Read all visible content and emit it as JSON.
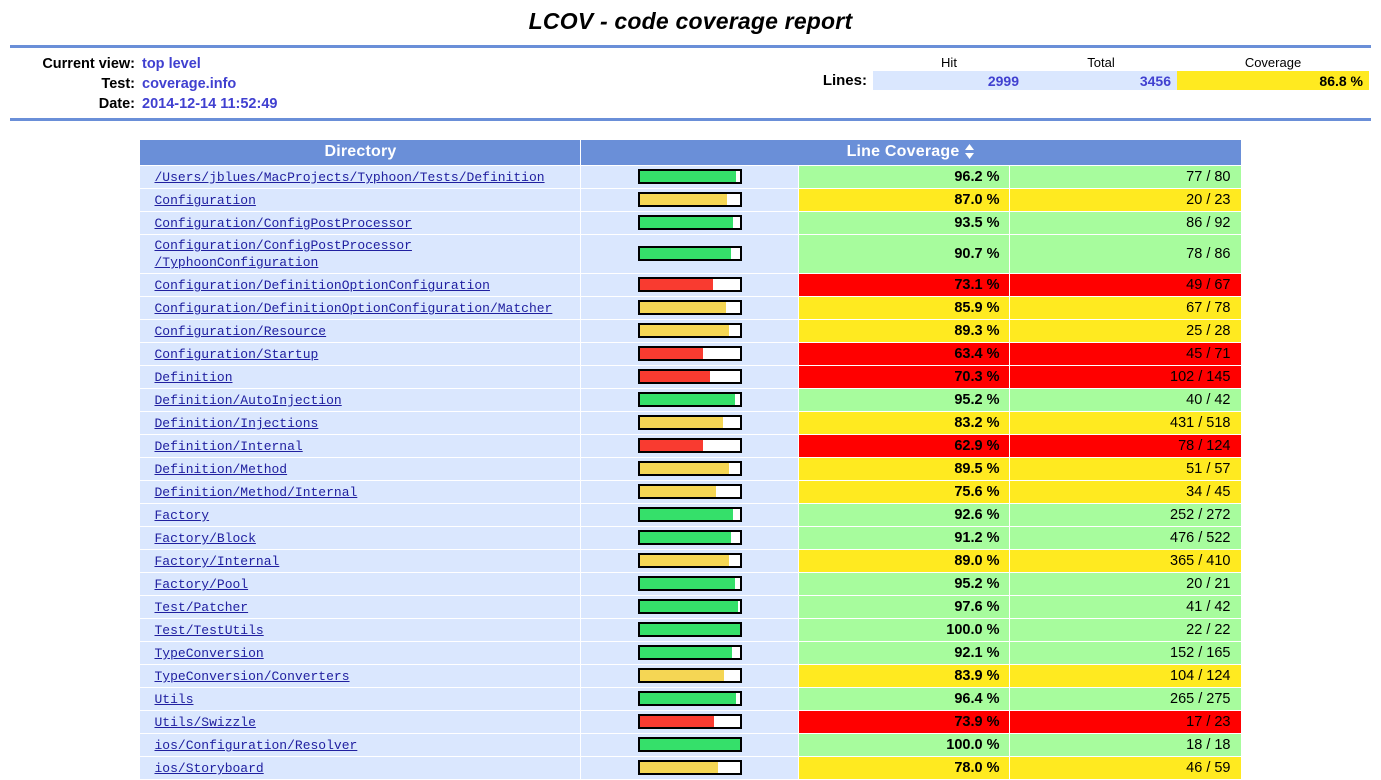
{
  "title": "LCOV - code coverage report",
  "info": {
    "rows": [
      {
        "label": "Current view:",
        "value": "top level"
      },
      {
        "label": "Test:",
        "value": "coverage.info"
      },
      {
        "label": "Date:",
        "value": "2014-12-14 11:52:49"
      }
    ],
    "summary": {
      "headers": {
        "hit": "Hit",
        "total": "Total",
        "coverage": "Coverage"
      },
      "row_label": "Lines:",
      "hit": "2999",
      "total": "3456",
      "coverage": "86.8 %"
    }
  },
  "table": {
    "headers": {
      "directory": "Directory",
      "coverage": "Line Coverage"
    },
    "sort_icon": "sort-updown-icon",
    "rows": [
      {
        "dir": "/Users/jblues/MacProjects/Typhoon/Tests/Definition",
        "pct": "96.2 %",
        "ratio": "77 / 80",
        "fill": 96.2,
        "level": "hi"
      },
      {
        "dir": "Configuration",
        "pct": "87.0 %",
        "ratio": "20 / 23",
        "fill": 87.0,
        "level": "med"
      },
      {
        "dir": "Configuration/ConfigPostProcessor",
        "pct": "93.5 %",
        "ratio": "86 / 92",
        "fill": 93.5,
        "level": "hi"
      },
      {
        "dir": "Configuration/ConfigPostProcessor\n/TyphoonConfiguration",
        "pct": "90.7 %",
        "ratio": "78 / 86",
        "fill": 90.7,
        "level": "hi"
      },
      {
        "dir": "Configuration/DefinitionOptionConfiguration",
        "pct": "73.1 %",
        "ratio": "49 / 67",
        "fill": 73.1,
        "level": "lo"
      },
      {
        "dir": "Configuration/DefinitionOptionConfiguration/Matcher",
        "pct": "85.9 %",
        "ratio": "67 / 78",
        "fill": 85.9,
        "level": "med"
      },
      {
        "dir": "Configuration/Resource",
        "pct": "89.3 %",
        "ratio": "25 / 28",
        "fill": 89.3,
        "level": "med"
      },
      {
        "dir": "Configuration/Startup",
        "pct": "63.4 %",
        "ratio": "45 / 71",
        "fill": 63.4,
        "level": "lo"
      },
      {
        "dir": "Definition",
        "pct": "70.3 %",
        "ratio": "102 / 145",
        "fill": 70.3,
        "level": "lo"
      },
      {
        "dir": "Definition/AutoInjection",
        "pct": "95.2 %",
        "ratio": "40 / 42",
        "fill": 95.2,
        "level": "hi"
      },
      {
        "dir": "Definition/Injections",
        "pct": "83.2 %",
        "ratio": "431 / 518",
        "fill": 83.2,
        "level": "med"
      },
      {
        "dir": "Definition/Internal",
        "pct": "62.9 %",
        "ratio": "78 / 124",
        "fill": 62.9,
        "level": "lo"
      },
      {
        "dir": "Definition/Method",
        "pct": "89.5 %",
        "ratio": "51 / 57",
        "fill": 89.5,
        "level": "med"
      },
      {
        "dir": "Definition/Method/Internal",
        "pct": "75.6 %",
        "ratio": "34 / 45",
        "fill": 75.6,
        "level": "med"
      },
      {
        "dir": "Factory",
        "pct": "92.6 %",
        "ratio": "252 / 272",
        "fill": 92.6,
        "level": "hi"
      },
      {
        "dir": "Factory/Block",
        "pct": "91.2 %",
        "ratio": "476 / 522",
        "fill": 91.2,
        "level": "hi"
      },
      {
        "dir": "Factory/Internal",
        "pct": "89.0 %",
        "ratio": "365 / 410",
        "fill": 89.0,
        "level": "med"
      },
      {
        "dir": "Factory/Pool",
        "pct": "95.2 %",
        "ratio": "20 / 21",
        "fill": 95.2,
        "level": "hi"
      },
      {
        "dir": "Test/Patcher",
        "pct": "97.6 %",
        "ratio": "41 / 42",
        "fill": 97.6,
        "level": "hi"
      },
      {
        "dir": "Test/TestUtils",
        "pct": "100.0 %",
        "ratio": "22 / 22",
        "fill": 100.0,
        "level": "hi"
      },
      {
        "dir": "TypeConversion",
        "pct": "92.1 %",
        "ratio": "152 / 165",
        "fill": 92.1,
        "level": "hi"
      },
      {
        "dir": "TypeConversion/Converters",
        "pct": "83.9 %",
        "ratio": "104 / 124",
        "fill": 83.9,
        "level": "med"
      },
      {
        "dir": "Utils",
        "pct": "96.4 %",
        "ratio": "265 / 275",
        "fill": 96.4,
        "level": "hi"
      },
      {
        "dir": "Utils/Swizzle",
        "pct": "73.9 %",
        "ratio": "17 / 23",
        "fill": 73.9,
        "level": "lo"
      },
      {
        "dir": "ios/Configuration/Resolver",
        "pct": "100.0 %",
        "ratio": "18 / 18",
        "fill": 100.0,
        "level": "hi"
      },
      {
        "dir": "ios/Storyboard",
        "pct": "78.0 %",
        "ratio": "46 / 59",
        "fill": 78.0,
        "level": "med"
      }
    ]
  }
}
